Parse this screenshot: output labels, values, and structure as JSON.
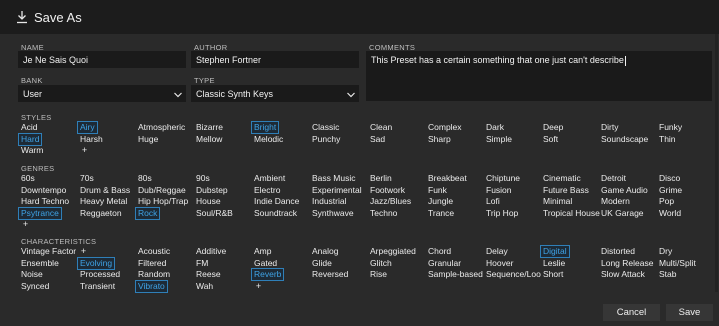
{
  "window": {
    "title": "Save As",
    "icon": "download-icon"
  },
  "fields": {
    "name": {
      "label": "NAME",
      "value": "Je Ne Sais Quoi"
    },
    "author": {
      "label": "AUTHOR",
      "value": "Stephen Fortner"
    },
    "comments": {
      "label": "COMMENTS",
      "value": "This Preset has a certain something that one just can't describe"
    },
    "bank": {
      "label": "BANK",
      "value": "User"
    },
    "type": {
      "label": "TYPE",
      "value": "Classic Synth Keys"
    }
  },
  "styles": {
    "label": "STYLES",
    "tags": [
      {
        "text": "Acid",
        "selected": false
      },
      {
        "text": "Airy",
        "selected": true
      },
      {
        "text": "Atmospheric",
        "selected": false
      },
      {
        "text": "Bizarre",
        "selected": false
      },
      {
        "text": "Bright",
        "selected": true
      },
      {
        "text": "Classic",
        "selected": false
      },
      {
        "text": "Clean",
        "selected": false
      },
      {
        "text": "Complex",
        "selected": false
      },
      {
        "text": "Dark",
        "selected": false
      },
      {
        "text": "Deep",
        "selected": false
      },
      {
        "text": "Dirty",
        "selected": false
      },
      {
        "text": "Funky",
        "selected": false
      },
      {
        "text": "Hard",
        "selected": true
      },
      {
        "text": "Harsh",
        "selected": false
      },
      {
        "text": "Huge",
        "selected": false
      },
      {
        "text": "Mellow",
        "selected": false
      },
      {
        "text": "Melodic",
        "selected": false
      },
      {
        "text": "Punchy",
        "selected": false
      },
      {
        "text": "Sad",
        "selected": false
      },
      {
        "text": "Sharp",
        "selected": false
      },
      {
        "text": "Simple",
        "selected": false
      },
      {
        "text": "Soft",
        "selected": false
      },
      {
        "text": "Soundscape",
        "selected": false
      },
      {
        "text": "Thin",
        "selected": false
      },
      {
        "text": "Warm",
        "selected": false
      }
    ],
    "add": "+"
  },
  "genres": {
    "label": "GENRES",
    "tags": [
      {
        "text": "60s",
        "selected": false
      },
      {
        "text": "70s",
        "selected": false
      },
      {
        "text": "80s",
        "selected": false
      },
      {
        "text": "90s",
        "selected": false
      },
      {
        "text": "Ambient",
        "selected": false
      },
      {
        "text": "Bass Music",
        "selected": false
      },
      {
        "text": "Berlin",
        "selected": false
      },
      {
        "text": "Breakbeat",
        "selected": false
      },
      {
        "text": "Chiptune",
        "selected": false
      },
      {
        "text": "Cinematic",
        "selected": false
      },
      {
        "text": "Detroit",
        "selected": false
      },
      {
        "text": "Disco",
        "selected": false
      },
      {
        "text": "Downtempo",
        "selected": false
      },
      {
        "text": "Drum & Bass",
        "selected": false
      },
      {
        "text": "Dub/Reggae",
        "selected": false
      },
      {
        "text": "Dubstep",
        "selected": false
      },
      {
        "text": "Electro",
        "selected": false
      },
      {
        "text": "Experimental",
        "selected": false
      },
      {
        "text": "Footwork",
        "selected": false
      },
      {
        "text": "Funk",
        "selected": false
      },
      {
        "text": "Fusion",
        "selected": false
      },
      {
        "text": "Future Bass",
        "selected": false
      },
      {
        "text": "Game Audio",
        "selected": false
      },
      {
        "text": "Grime",
        "selected": false
      },
      {
        "text": "Hard Techno",
        "selected": false
      },
      {
        "text": "Heavy Metal",
        "selected": false
      },
      {
        "text": "Hip Hop/Trap",
        "selected": false
      },
      {
        "text": "House",
        "selected": false
      },
      {
        "text": "Indie Dance",
        "selected": false
      },
      {
        "text": "Industrial",
        "selected": false
      },
      {
        "text": "Jazz/Blues",
        "selected": false
      },
      {
        "text": "Jungle",
        "selected": false
      },
      {
        "text": "Lofi",
        "selected": false
      },
      {
        "text": "Minimal",
        "selected": false
      },
      {
        "text": "Modern",
        "selected": false
      },
      {
        "text": "Pop",
        "selected": false
      },
      {
        "text": "Psytrance",
        "selected": true
      },
      {
        "text": "Reggaeton",
        "selected": false
      },
      {
        "text": "Rock",
        "selected": true
      },
      {
        "text": "Soul/R&B",
        "selected": false
      },
      {
        "text": "Soundtrack",
        "selected": false
      },
      {
        "text": "Synthwave",
        "selected": false
      },
      {
        "text": "Techno",
        "selected": false
      },
      {
        "text": "Trance",
        "selected": false
      },
      {
        "text": "Trip Hop",
        "selected": false
      },
      {
        "text": "Tropical House",
        "selected": false
      },
      {
        "text": "UK Garage",
        "selected": false
      },
      {
        "text": "World",
        "selected": false
      }
    ],
    "add": "+"
  },
  "characteristics": {
    "label": "CHARACTERISTICS",
    "tags": [
      {
        "text": "Vintage Factor",
        "selected": false
      },
      {
        "text": "+",
        "selected": false
      },
      {
        "text": "Acoustic",
        "selected": false
      },
      {
        "text": "Additive",
        "selected": false
      },
      {
        "text": "Amp",
        "selected": false
      },
      {
        "text": "Analog",
        "selected": false
      },
      {
        "text": "Arpeggiated",
        "selected": false
      },
      {
        "text": "Chord",
        "selected": false
      },
      {
        "text": "Delay",
        "selected": false
      },
      {
        "text": "Digital",
        "selected": true
      },
      {
        "text": "Distorted",
        "selected": false
      },
      {
        "text": "Dry",
        "selected": false
      },
      {
        "text": "Ensemble",
        "selected": false
      },
      {
        "text": "Evolving",
        "selected": true
      },
      {
        "text": "Filtered",
        "selected": false
      },
      {
        "text": "FM",
        "selected": false
      },
      {
        "text": "Gated",
        "selected": false
      },
      {
        "text": "Glide",
        "selected": false
      },
      {
        "text": "Glitch",
        "selected": false
      },
      {
        "text": "Granular",
        "selected": false
      },
      {
        "text": "Hoover",
        "selected": false
      },
      {
        "text": "Leslie",
        "selected": false
      },
      {
        "text": "Long Release",
        "selected": false
      },
      {
        "text": "Multi/Split",
        "selected": false
      },
      {
        "text": "Noise",
        "selected": false
      },
      {
        "text": "Processed",
        "selected": false
      },
      {
        "text": "Random",
        "selected": false
      },
      {
        "text": "Reese",
        "selected": false
      },
      {
        "text": "Reverb",
        "selected": true
      },
      {
        "text": "Reversed",
        "selected": false
      },
      {
        "text": "Rise",
        "selected": false
      },
      {
        "text": "Sample-based",
        "selected": false
      },
      {
        "text": "Sequence/Loo",
        "selected": false
      },
      {
        "text": "Short",
        "selected": false
      },
      {
        "text": "Slow Attack",
        "selected": false
      },
      {
        "text": "Stab",
        "selected": false
      },
      {
        "text": "Synced",
        "selected": false
      },
      {
        "text": "Transient",
        "selected": false
      },
      {
        "text": "Vibrato",
        "selected": true
      },
      {
        "text": "Wah",
        "selected": false
      }
    ],
    "add": "+"
  },
  "buttons": {
    "cancel": "Cancel",
    "save": "Save"
  },
  "colors": {
    "selected_tag": "#3fa3e6",
    "background": "#2a2a2a",
    "field": "#1a1a1a",
    "titlebar": "#1c1c1c"
  }
}
